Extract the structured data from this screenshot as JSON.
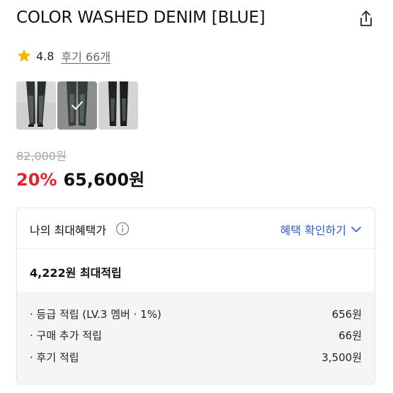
{
  "product": {
    "title": "COLOR WASHED DENIM [BLUE]",
    "rating": "4.8",
    "reviews_label": "후기 66개",
    "original_price": "82,000원",
    "discount_rate": "20%",
    "sale_price": "65,600원"
  },
  "thumbnails": [
    {
      "name": "thumb-1",
      "selected": false
    },
    {
      "name": "thumb-2",
      "selected": true
    },
    {
      "name": "thumb-3",
      "selected": false
    }
  ],
  "icons": {
    "share": "share-icon",
    "star": "star-icon",
    "info": "info-icon",
    "chevron": "chevron-down-icon",
    "check": "check-icon"
  },
  "colors": {
    "discount": "#e5212e",
    "link": "#2d5bd6",
    "star": "#f5b301",
    "breakdown_bg": "#f5f5f5"
  },
  "benefit": {
    "title": "나의 최대혜택가",
    "check_link": "혜택 확인하기",
    "max_points": "4,222원 최대적립",
    "rows": [
      {
        "label": "· 등급 적립 (LV.3 멤버 · 1%)",
        "value": "656원"
      },
      {
        "label": "· 구매 추가 적립",
        "value": "66원"
      },
      {
        "label": "· 후기 적립",
        "value": "3,500원"
      }
    ]
  }
}
